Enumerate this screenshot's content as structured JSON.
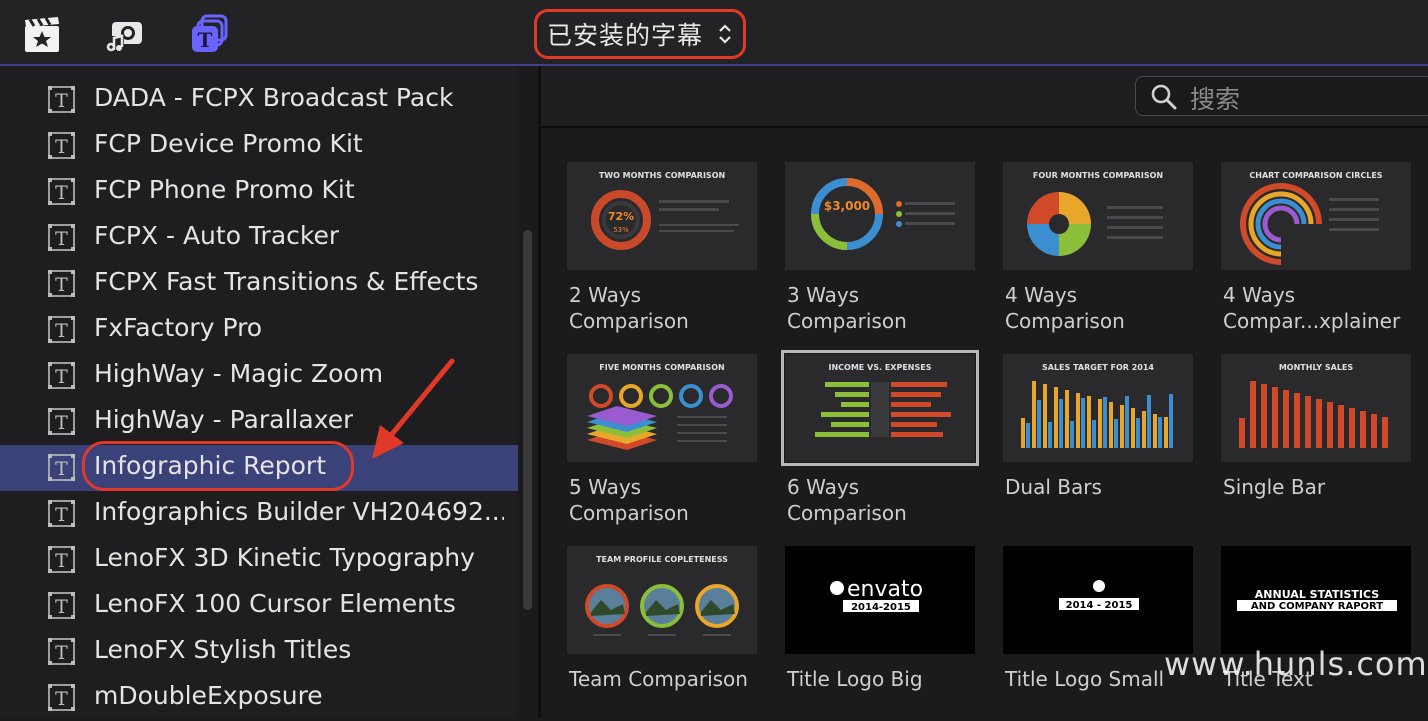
{
  "toolbar": {
    "dropdown_label": "已安装的字幕"
  },
  "sidebar": {
    "items": [
      {
        "label": "DADA - FCPX Broadcast Pack"
      },
      {
        "label": "FCP Device Promo Kit"
      },
      {
        "label": "FCP Phone Promo Kit"
      },
      {
        "label": "FCPX - Auto Tracker"
      },
      {
        "label": "FCPX Fast Transitions & Effects"
      },
      {
        "label": "FxFactory Pro"
      },
      {
        "label": "HighWay - Magic Zoom"
      },
      {
        "label": "HighWay - Parallaxer"
      },
      {
        "label": "Infographic Report",
        "selected": true
      },
      {
        "label": "Infographics Builder VH204692..."
      },
      {
        "label": "LenoFX 3D Kinetic Typography"
      },
      {
        "label": "LenoFX 100 Cursor Elements"
      },
      {
        "label": "LenoFX Stylish Titles"
      },
      {
        "label": "mDoubleExposure"
      }
    ]
  },
  "search": {
    "placeholder": "搜索"
  },
  "browser": {
    "tiles": [
      {
        "label": "2 Ways\nComparison",
        "thumb_title": "TWO MONTHS COMPARISON",
        "center_value": "72%",
        "sub_value": "53%"
      },
      {
        "label": "3 Ways\nComparison",
        "thumb_title": "",
        "center_value": "$3,000"
      },
      {
        "label": "4 Ways\nComparison",
        "thumb_title": "FOUR MONTHS COMPARISON"
      },
      {
        "label": "4 Ways\nCompar...xplainer",
        "thumb_title": "CHART COMPARISON CIRCLES"
      },
      {
        "label": "5 Ways\nComparison",
        "thumb_title": "FIVE MONTHS COMPARISON"
      },
      {
        "label": "6 Ways\nComparison",
        "thumb_title": "INCOME VS. EXPENSES",
        "selected": true
      },
      {
        "label": "Dual Bars",
        "thumb_title": "SALES TARGET FOR 2014"
      },
      {
        "label": "Single Bar",
        "thumb_title": "MONTHLY SALES"
      },
      {
        "label": "Team Comparison",
        "thumb_title": "TEAM PROFILE COPLETENESS"
      },
      {
        "label": "Title Logo Big",
        "thumb_title": "envato",
        "thumb_sub": "2014-2015"
      },
      {
        "label": "Title Logo Small",
        "thumb_sub": "2014 - 2015"
      },
      {
        "label": "Title Text",
        "thumb_title": "ANNUAL STATISTICS",
        "thumb_sub": "AND COMPANY RAPORT"
      }
    ]
  },
  "watermark": "www.hunls.com",
  "colors": {
    "accent_red": "#e0392a",
    "selection": "#3b4179",
    "panel": "#1e1e20"
  },
  "icons": [
    "clapper-star-icon",
    "music-camera-icon",
    "title-icon",
    "chevron-updown-icon",
    "search-icon",
    "title-t-icon"
  ]
}
